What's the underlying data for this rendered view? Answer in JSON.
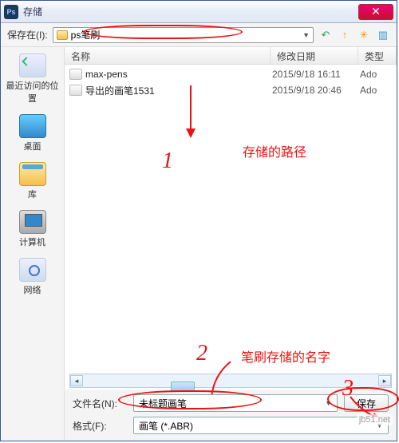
{
  "titlebar": {
    "app_icon_text": "Ps",
    "title": "存储"
  },
  "pathbar": {
    "label": "保存在(I):",
    "folder": "ps笔刷",
    "icons": {
      "back": "↶",
      "up": "↑",
      "newfolder": "✳",
      "views": "▥"
    }
  },
  "sidebar": [
    {
      "name": "recent",
      "label": "最近访问的位置"
    },
    {
      "name": "desktop",
      "label": "桌面"
    },
    {
      "name": "libraries",
      "label": "库"
    },
    {
      "name": "computer",
      "label": "计算机"
    },
    {
      "name": "network",
      "label": "网络"
    }
  ],
  "columns": {
    "name": "名称",
    "date": "修改日期",
    "type": "类型"
  },
  "files": [
    {
      "name": "max-pens",
      "date": "2015/9/18 16:11",
      "type": "Ado"
    },
    {
      "name": "导出的画笔1531",
      "date": "2015/9/18 20:46",
      "type": "Ado"
    }
  ],
  "filename_row": {
    "label": "文件名(N):",
    "value": "未标题画笔"
  },
  "format_row": {
    "label": "格式(F):",
    "value": "画笔 (*.ABR)"
  },
  "save_button": "保存",
  "annotations": {
    "n1": "1",
    "t1": "存储的路径",
    "n2": "2",
    "t2": "笔刷存储的名字",
    "n3": "3"
  },
  "watermark": "jb51.net"
}
